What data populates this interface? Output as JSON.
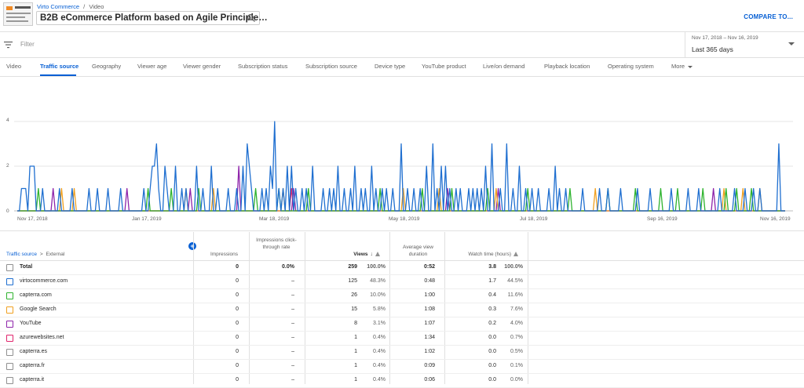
{
  "header": {
    "breadcrumb_channel": "Virto Commerce",
    "breadcrumb_sep": "/",
    "breadcrumb_page": "Video",
    "video_title": "B2B eCommerce Platform based on Agile Principle…",
    "compare_label": "COMPARE TO..."
  },
  "filter": {
    "placeholder": "Filter"
  },
  "date": {
    "range": "Nov 17, 2018 – Nov 16, 2019",
    "period": "Last 365 days"
  },
  "tabs": [
    {
      "label": "Video"
    },
    {
      "label": "Traffic source"
    },
    {
      "label": "Geography"
    },
    {
      "label": "Viewer age"
    },
    {
      "label": "Viewer gender"
    },
    {
      "label": "Subscription status"
    },
    {
      "label": "Subscription source"
    },
    {
      "label": "Device type"
    },
    {
      "label": "YouTube product"
    },
    {
      "label": "Live/on demand"
    },
    {
      "label": "Playback location"
    },
    {
      "label": "Operating system"
    },
    {
      "label": "More"
    }
  ],
  "chart_data": {
    "type": "line",
    "yticks": [
      "0",
      "2",
      "4"
    ],
    "ylim": [
      0,
      4
    ],
    "x_labels": [
      "Nov 17, 2018",
      "Jan 17, 2019",
      "Mar 18, 2019",
      "May 18, 2019",
      "Jul 18, 2019",
      "Sep 16, 2019",
      "Nov 16, 2019"
    ],
    "grid": true,
    "n_days": 365,
    "series": [
      {
        "name": "virtocommerce.com",
        "color": "#1f6fd0",
        "spikes": [
          [
            2,
            1
          ],
          [
            3,
            1
          ],
          [
            4,
            1
          ],
          [
            6,
            2
          ],
          [
            7,
            2
          ],
          [
            8,
            2
          ],
          [
            12,
            1
          ],
          [
            20,
            1
          ],
          [
            26,
            1
          ],
          [
            34,
            1
          ],
          [
            38,
            1
          ],
          [
            43,
            1
          ],
          [
            49,
            1
          ],
          [
            60,
            1
          ],
          [
            63,
            1
          ],
          [
            64,
            2
          ],
          [
            65,
            2
          ],
          [
            66,
            3
          ],
          [
            67,
            1
          ],
          [
            70,
            2
          ],
          [
            71,
            1
          ],
          [
            75,
            2
          ],
          [
            78,
            1
          ],
          [
            80,
            1
          ],
          [
            85,
            2
          ],
          [
            88,
            1
          ],
          [
            92,
            2
          ],
          [
            95,
            1
          ],
          [
            100,
            1
          ],
          [
            104,
            1
          ],
          [
            107,
            2
          ],
          [
            109,
            3
          ],
          [
            110,
            2
          ],
          [
            111,
            1
          ],
          [
            116,
            1
          ],
          [
            118,
            1
          ],
          [
            120,
            2
          ],
          [
            121,
            1
          ],
          [
            122,
            4
          ],
          [
            124,
            1
          ],
          [
            126,
            1
          ],
          [
            128,
            2
          ],
          [
            130,
            2
          ],
          [
            132,
            1
          ],
          [
            135,
            1
          ],
          [
            137,
            1
          ],
          [
            140,
            2
          ],
          [
            145,
            1
          ],
          [
            148,
            1
          ],
          [
            150,
            1
          ],
          [
            152,
            2
          ],
          [
            155,
            1
          ],
          [
            158,
            1
          ],
          [
            160,
            2
          ],
          [
            163,
            1
          ],
          [
            165,
            1
          ],
          [
            168,
            2
          ],
          [
            170,
            1
          ],
          [
            173,
            1
          ],
          [
            175,
            1
          ],
          [
            178,
            1
          ],
          [
            182,
            3
          ],
          [
            185,
            1
          ],
          [
            188,
            1
          ],
          [
            191,
            1
          ],
          [
            194,
            2
          ],
          [
            197,
            3
          ],
          [
            199,
            1
          ],
          [
            201,
            2
          ],
          [
            203,
            2
          ],
          [
            205,
            1
          ],
          [
            208,
            1
          ],
          [
            210,
            1
          ],
          [
            214,
            1
          ],
          [
            216,
            1
          ],
          [
            218,
            1
          ],
          [
            220,
            1
          ],
          [
            222,
            2
          ],
          [
            225,
            3
          ],
          [
            229,
            1
          ],
          [
            232,
            3
          ],
          [
            235,
            1
          ],
          [
            238,
            2
          ],
          [
            241,
            1
          ],
          [
            244,
            1
          ],
          [
            247,
            1
          ],
          [
            252,
            1
          ],
          [
            255,
            2
          ],
          [
            257,
            1
          ],
          [
            260,
            1
          ],
          [
            268,
            1
          ],
          [
            276,
            1
          ],
          [
            280,
            1
          ],
          [
            286,
            1
          ],
          [
            294,
            1
          ],
          [
            300,
            1
          ],
          [
            310,
            1
          ],
          [
            318,
            1
          ],
          [
            323,
            1
          ],
          [
            333,
            1
          ],
          [
            340,
            1
          ],
          [
            345,
            1
          ],
          [
            349,
            1
          ],
          [
            352,
            1
          ],
          [
            361,
            3
          ]
        ]
      },
      {
        "name": "capterra.com",
        "color": "#2eb32e",
        "spikes": [
          [
            10,
            1
          ],
          [
            62,
            1
          ],
          [
            73,
            1
          ],
          [
            86,
            1
          ],
          [
            113,
            1
          ],
          [
            124,
            1
          ],
          [
            138,
            1
          ],
          [
            172,
            1
          ],
          [
            192,
            1
          ],
          [
            206,
            1
          ],
          [
            223,
            1
          ],
          [
            242,
            1
          ],
          [
            262,
            1
          ],
          [
            280,
            1
          ],
          [
            293,
            1
          ],
          [
            305,
            1
          ],
          [
            313,
            1
          ],
          [
            325,
            1
          ],
          [
            336,
            1
          ],
          [
            341,
            1
          ],
          [
            348,
            1
          ]
        ]
      },
      {
        "name": "Google Search",
        "color": "#f0a020",
        "spikes": [
          [
            21,
            1
          ],
          [
            27,
            1
          ],
          [
            80,
            1
          ],
          [
            93,
            1
          ],
          [
            126,
            1
          ],
          [
            183,
            1
          ],
          [
            200,
            1
          ],
          [
            227,
            1
          ],
          [
            274,
            1
          ],
          [
            335,
            1
          ],
          [
            344,
            1
          ],
          [
            352,
            1
          ]
        ]
      },
      {
        "name": "YouTube",
        "color": "#8e24aa",
        "spikes": [
          [
            17,
            1
          ],
          [
            52,
            1
          ],
          [
            82,
            1
          ],
          [
            105,
            2
          ],
          [
            131,
            1
          ],
          [
            204,
            1
          ],
          [
            228,
            1
          ],
          [
            330,
            1
          ]
        ]
      },
      {
        "name": "azurewebsites.net",
        "color": "#e0246c",
        "spikes": [
          [
            130,
            1
          ]
        ]
      }
    ]
  },
  "table": {
    "source_label": "Traffic source",
    "source_sep": ">",
    "source_sub": "External",
    "add_label": "+",
    "columns": {
      "impressions": "Impressions",
      "ctr": "Impressions click-through rate",
      "views": "Views",
      "avd": "Average view duration",
      "watch": "Watch time (hours)"
    },
    "rows": [
      {
        "name": "Total",
        "color": "#909090",
        "impressions": "0",
        "ctr": "0.0%",
        "views": "259",
        "views_pct": "100.0%",
        "avd": "0:52",
        "watch": "3.8",
        "watch_pct": "100.0%",
        "total": true
      },
      {
        "name": "virtocommerce.com",
        "color": "#1f6fd0",
        "impressions": "0",
        "ctr": "–",
        "views": "125",
        "views_pct": "48.3%",
        "avd": "0:48",
        "watch": "1.7",
        "watch_pct": "44.5%"
      },
      {
        "name": "capterra.com",
        "color": "#2eb32e",
        "impressions": "0",
        "ctr": "–",
        "views": "26",
        "views_pct": "10.0%",
        "avd": "1:00",
        "watch": "0.4",
        "watch_pct": "11.6%"
      },
      {
        "name": "Google Search",
        "color": "#f0a020",
        "impressions": "0",
        "ctr": "–",
        "views": "15",
        "views_pct": "5.8%",
        "avd": "1:08",
        "watch": "0.3",
        "watch_pct": "7.6%"
      },
      {
        "name": "YouTube",
        "color": "#8e24aa",
        "impressions": "0",
        "ctr": "–",
        "views": "8",
        "views_pct": "3.1%",
        "avd": "1:07",
        "watch": "0.2",
        "watch_pct": "4.0%"
      },
      {
        "name": "azurewebsites.net",
        "color": "#e0246c",
        "impressions": "0",
        "ctr": "–",
        "views": "1",
        "views_pct": "0.4%",
        "avd": "1:34",
        "watch": "0.0",
        "watch_pct": "0.7%"
      },
      {
        "name": "capterra.es",
        "color": "#909090",
        "impressions": "0",
        "ctr": "–",
        "views": "1",
        "views_pct": "0.4%",
        "avd": "1:02",
        "watch": "0.0",
        "watch_pct": "0.5%"
      },
      {
        "name": "capterra.fr",
        "color": "#909090",
        "impressions": "0",
        "ctr": "–",
        "views": "1",
        "views_pct": "0.4%",
        "avd": "0:09",
        "watch": "0.0",
        "watch_pct": "0.1%"
      },
      {
        "name": "capterra.it",
        "color": "#909090",
        "impressions": "0",
        "ctr": "–",
        "views": "1",
        "views_pct": "0.4%",
        "avd": "0:06",
        "watch": "0.0",
        "watch_pct": "0.0%"
      }
    ]
  }
}
